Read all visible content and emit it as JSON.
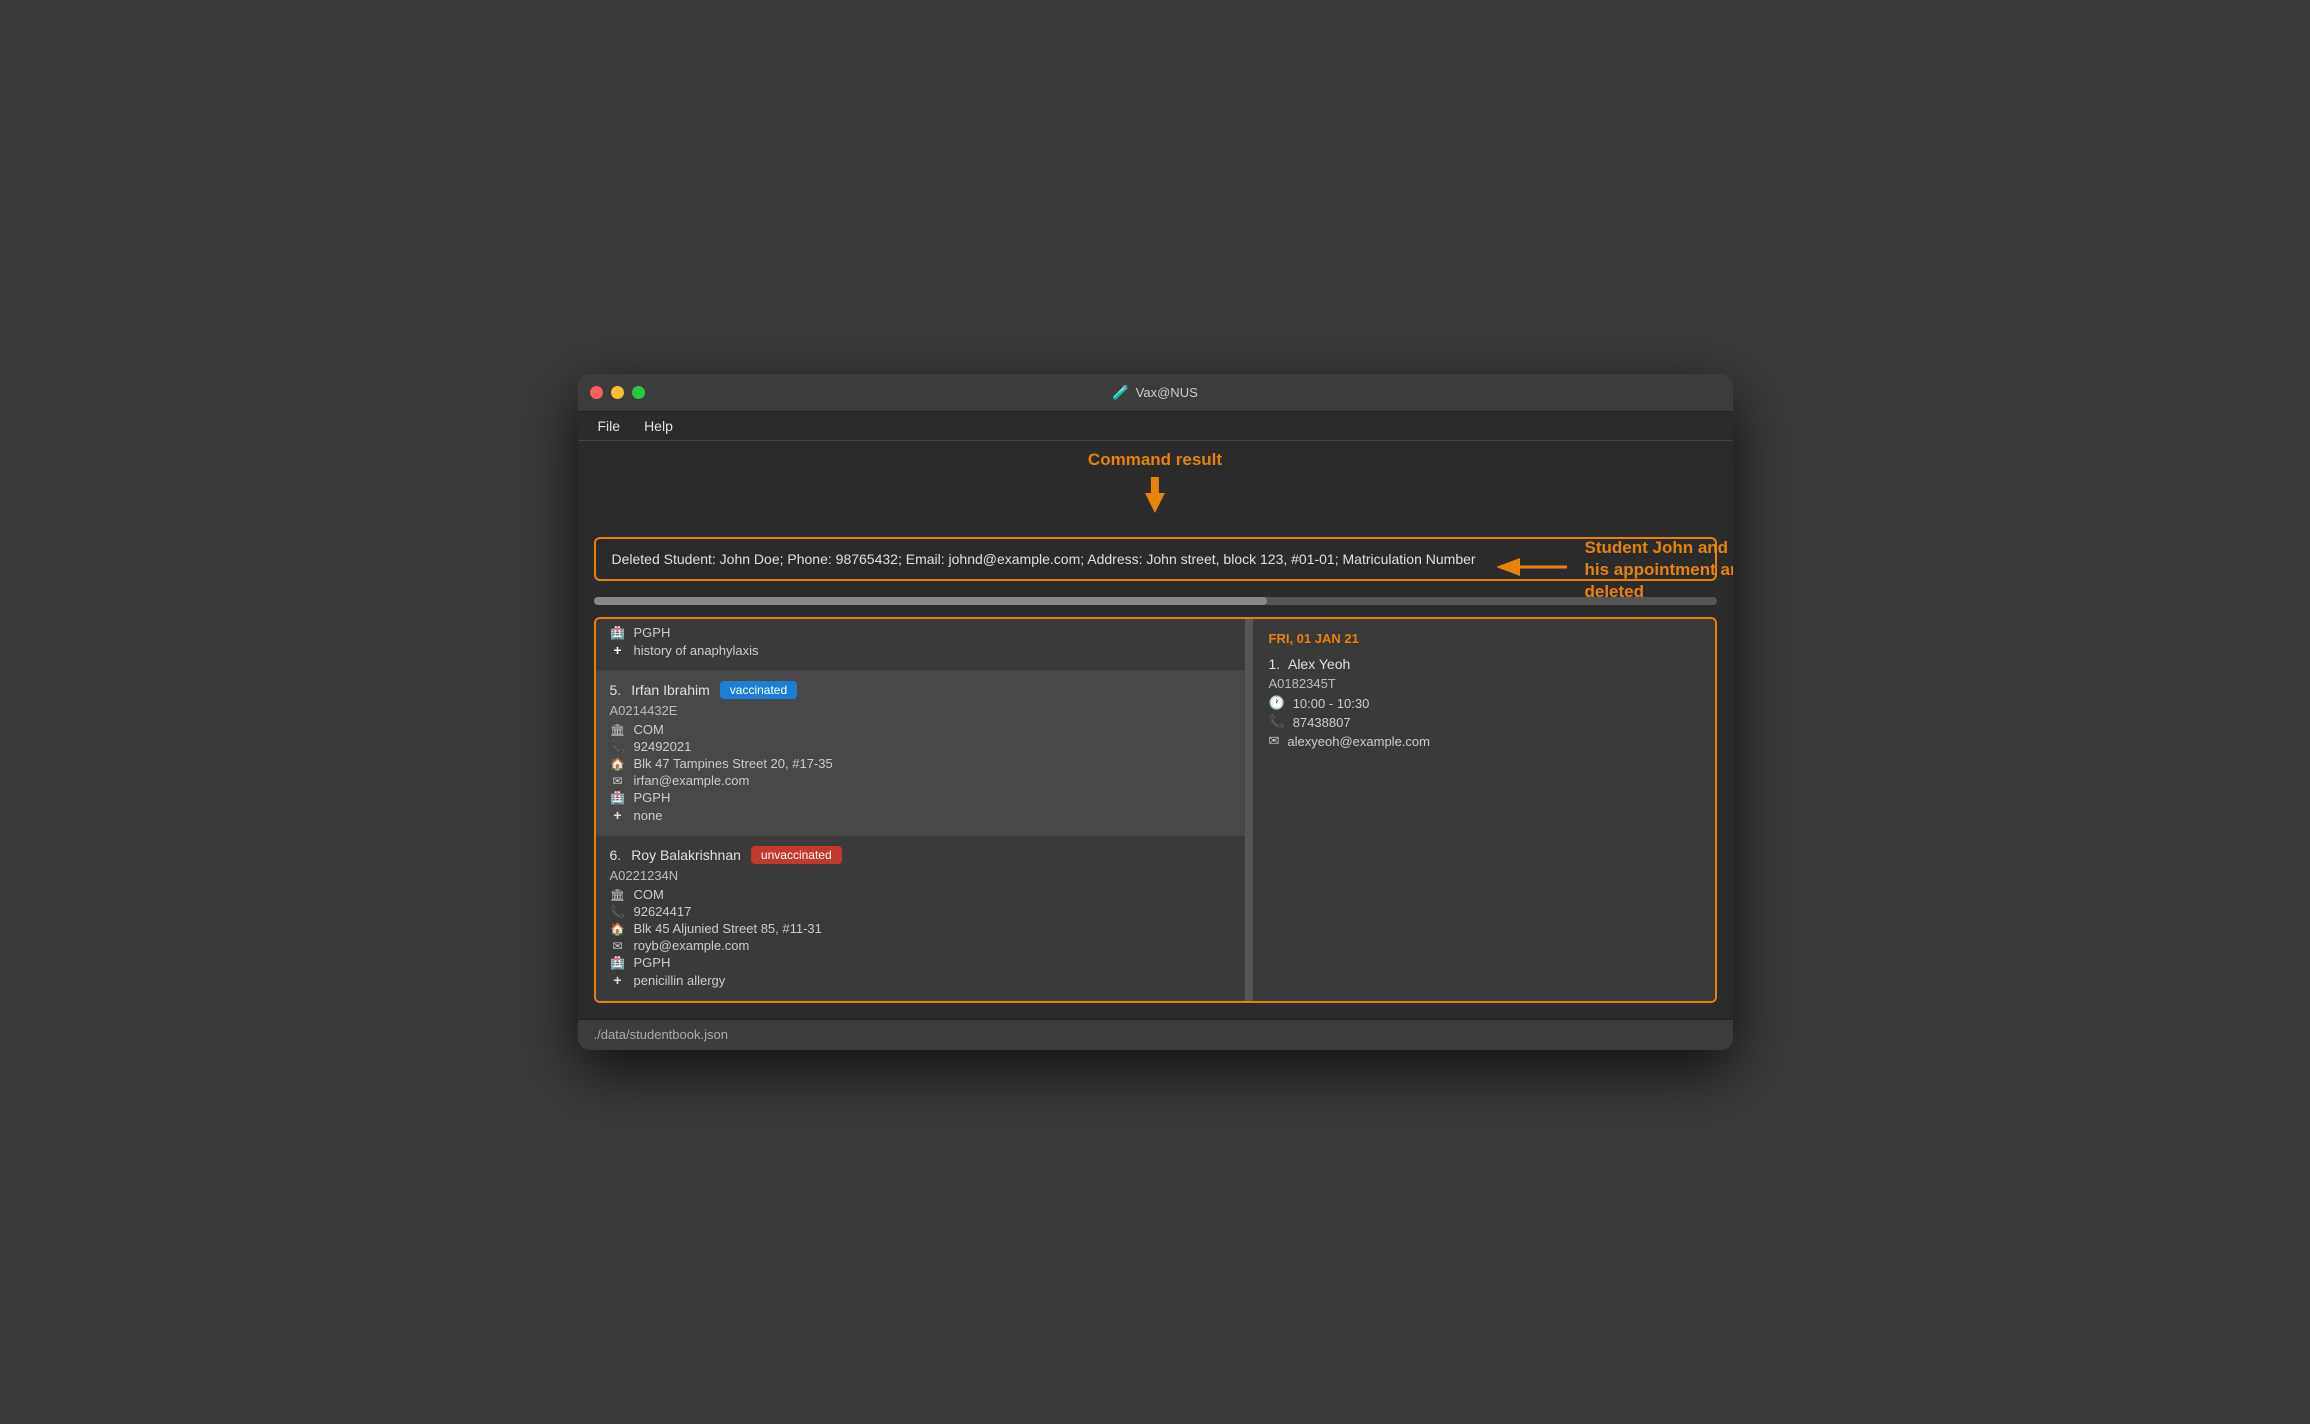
{
  "window": {
    "title": "Vax@NUS",
    "title_icon": "🧪"
  },
  "menu": {
    "items": [
      "File",
      "Help"
    ]
  },
  "annotations": {
    "command_result_label": "Command\nresult",
    "student_john_label": "Student John and his\nappointment are deleted"
  },
  "result_box": {
    "text": "Deleted Student: John Doe; Phone: 98765432; Email: johnd@example.com; Address: John street, block 123, #01-01; Matriculation Number"
  },
  "students": [
    {
      "number": "5.",
      "name": "Irfan Ibrahim",
      "status": "vaccinated",
      "matric": "A0214432E",
      "faculty": "COM",
      "phone": "92492021",
      "address": "Blk 47 Tampines Street 20, #17-35",
      "email": "irfan@example.com",
      "hall": "PGPH",
      "medical": "none",
      "highlighted": true
    },
    {
      "number": "6.",
      "name": "Roy Balakrishnan",
      "status": "unvaccinated",
      "matric": "A0221234N",
      "faculty": "COM",
      "phone": "92624417",
      "address": "Blk 45 Aljunied Street 85, #11-31",
      "email": "royb@example.com",
      "hall": "PGPH",
      "medical": "penicillin allergy",
      "highlighted": false
    }
  ],
  "partial_student": {
    "hall": "PGPH",
    "medical": "history of anaphylaxis"
  },
  "appointment": {
    "date": "FRI, 01 JAN 21",
    "number": "1.",
    "name": "Alex Yeoh",
    "matric": "A0182345T",
    "time": "10:00 - 10:30",
    "phone": "87438807",
    "email": "alexyeoh@example.com"
  },
  "status_bar": {
    "path": "./data/studentbook.json"
  }
}
